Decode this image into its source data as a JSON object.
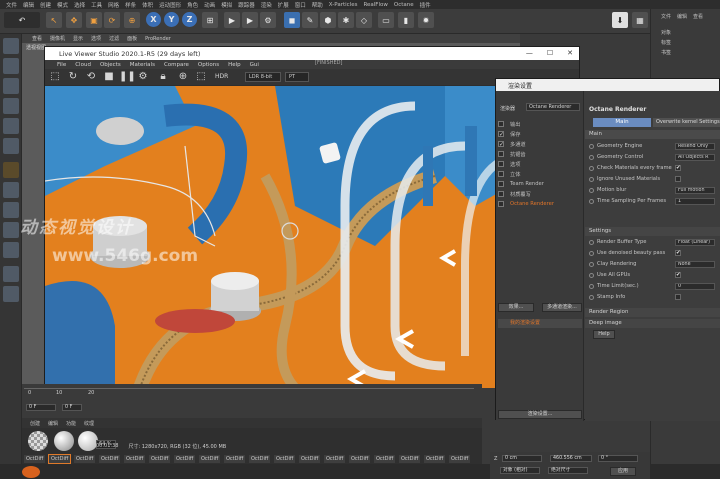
{
  "c4d": {
    "menu": [
      "文件",
      "编辑",
      "创建",
      "模式",
      "选择",
      "工具",
      "网格",
      "样条",
      "体积",
      "运动图形",
      "角色",
      "动画",
      "模拟",
      "跟踪器",
      "渲染",
      "扩展",
      "窗口",
      "帮助",
      "X-Particles",
      "RealFlow",
      "Octane",
      "插件"
    ],
    "axis_buttons": [
      "X",
      "Y",
      "Z"
    ],
    "viewport_menu": [
      "查看",
      "摄像机",
      "显示",
      "选项",
      "过滤",
      "面板",
      "ProRender"
    ],
    "viewport_label": "透视视图"
  },
  "live_viewer": {
    "title": "Live Viewer Studio 2020.1-R5 (29 days left)",
    "status": "[FINISHED]",
    "menu": [
      "File",
      "Cloud",
      "Objects",
      "Materials",
      "Compare",
      "Options",
      "Help",
      "Gui"
    ],
    "toolbar_icons": [
      "cube-icon",
      "refresh-icon",
      "refresh-alt-icon",
      "stop-icon",
      "pause-icon",
      "gear-icon",
      "lock-icon",
      "zoom-icon",
      "region-icon",
      "hdr-icon"
    ],
    "hdr_label": "HDR",
    "ldr_select": "LDR 8-bit",
    "mode_select": "PT",
    "win_buttons": [
      "—",
      "☐",
      "✕"
    ]
  },
  "viewer_status": {
    "zoom": "64 %",
    "time": "00:01:38",
    "info": "尺寸: 1280x720, RGB (32 位), 45.00 MB"
  },
  "render_settings": {
    "title": "渲染设置",
    "renderer_label": "渲染器",
    "renderer_value": "Octane Renderer",
    "left_items": [
      {
        "label": "输出",
        "checked": false
      },
      {
        "label": "保存",
        "checked": true
      },
      {
        "label": "多通道",
        "checked": true
      },
      {
        "label": "抗锯齿",
        "checked": false
      },
      {
        "label": "选项",
        "checked": false
      },
      {
        "label": "立体",
        "checked": false
      },
      {
        "label": "Team Render",
        "checked": false
      },
      {
        "label": "材质覆写",
        "checked": false
      },
      {
        "label": "Octane Renderer",
        "checked": false,
        "active": true
      }
    ],
    "effects_button": "效果...",
    "multi_button": "多通道渲染...",
    "my_settings": "我的渲染设置",
    "render_settings_button": "渲染设置...",
    "header": "Octane Renderer",
    "tabs": [
      "Main",
      "Overwrite kernel Settings"
    ],
    "section": "Main",
    "rows": [
      {
        "label": "Geometry Engine",
        "value": "Resend Only"
      },
      {
        "label": "Geometry Control",
        "value": "All Objects R"
      },
      {
        "label": "Check Materials every frame",
        "value": "✔"
      },
      {
        "label": "Ignore Unused Materials",
        "value": ""
      },
      {
        "label": "Motion blur",
        "value": "Full motion"
      },
      {
        "label": "Time Sampling Per Frames",
        "value": "1"
      }
    ],
    "settings_group": "Settings",
    "settings_rows": [
      {
        "label": "Render Buffer Type",
        "value": "Float (Linear)"
      },
      {
        "label": "Use denoised beauty pass",
        "value": "✔"
      },
      {
        "label": "Clay Rendering",
        "value": "None"
      },
      {
        "label": "Use All GPUs",
        "value": "✔"
      },
      {
        "label": "Time Limit(sec.)",
        "value": "0"
      },
      {
        "label": "Stamp Info",
        "value": ""
      }
    ],
    "render_region": "Render Region",
    "deep_image": "Deep image",
    "help_button": "Help"
  },
  "timeline": {
    "start": "0",
    "marker": "10",
    "end": "20",
    "frame_field": "0 F",
    "frame_field_2": "0 F"
  },
  "materials": {
    "menu": [
      "创建",
      "编辑",
      "功能",
      "纹理"
    ],
    "names": [
      "OctDiff",
      "OctDiff",
      "OctDiff",
      "OctDiff",
      "OctDiff",
      "OctDiff",
      "OctDiff",
      "OctDiff",
      "OctDiff",
      "OctDiff",
      "OctDiff",
      "OctDiff",
      "OctDiff",
      "OctDiff",
      "OctDiff",
      "OctDiff",
      "OctDiff",
      "OctDiff"
    ],
    "colors": [
      "#d9d9d9",
      "#9a9a9a",
      "#e8e8e8"
    ]
  },
  "right_panel": {
    "tabs": [
      "文件",
      "编辑",
      "查看"
    ],
    "items": [
      "对象",
      "标签",
      "书签"
    ]
  },
  "coords": {
    "z_label": "Z",
    "z_value": "0 cm",
    "z2_value": "460.556 cm",
    "b_value": "0 °",
    "mode": "对象 (相对)",
    "size_mode": "绝对尺寸",
    "apply": "应用"
  },
  "watermark": {
    "text": "动态视觉设计",
    "url": "www.546g.com"
  }
}
